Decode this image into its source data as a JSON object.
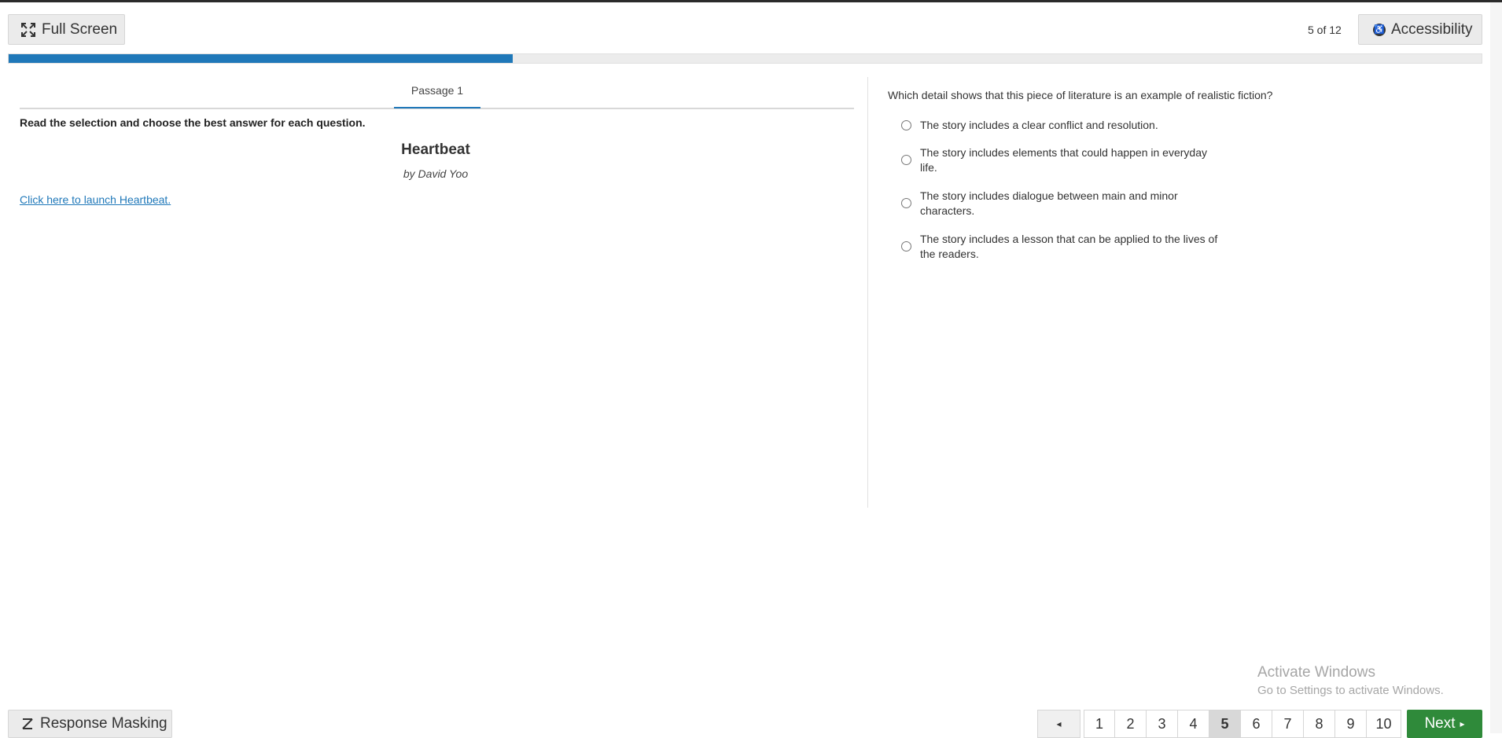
{
  "header": {
    "full_screen_label": "Full Screen",
    "counter": "5 of 12",
    "accessibility_label": "Accessibility"
  },
  "progress": {
    "fraction": 0.342,
    "color": "#1f78b9"
  },
  "passage": {
    "tab_label": "Passage 1",
    "instructions": "Read the selection and choose the best answer for each question.",
    "title": "Heartbeat",
    "author": "by David Yoo",
    "launch_link": "Click here to launch Heartbeat."
  },
  "question": {
    "stem": "Which detail shows that this piece of literature is an example of realistic fiction?",
    "options": [
      {
        "text": "The story includes a clear conflict and resolution."
      },
      {
        "text": "The story includes elements that could happen in everyday life."
      },
      {
        "text": "The story includes dialogue between main and minor characters."
      },
      {
        "text": "The story includes a lesson that can be applied to the lives of the readers."
      }
    ]
  },
  "watermark": {
    "line1": "Activate Windows",
    "line2": "Go to Settings to activate Windows."
  },
  "footer": {
    "response_masking_label": "Response Masking",
    "prev_label": "◂",
    "pages": [
      "1",
      "2",
      "3",
      "4",
      "5",
      "6",
      "7",
      "8",
      "9",
      "10"
    ],
    "active_page": "5",
    "next_label": "Next",
    "next_color": "#2f8a3a"
  }
}
